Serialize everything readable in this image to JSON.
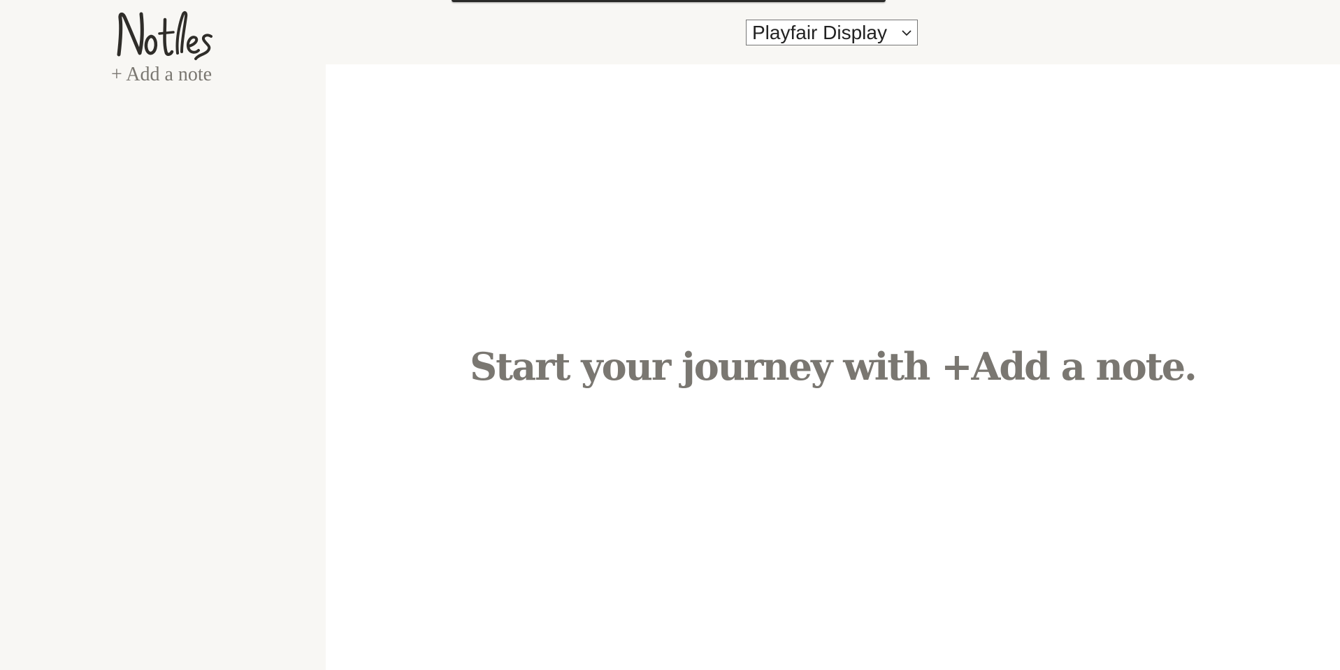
{
  "app": {
    "logo_text": "Notes"
  },
  "sidebar": {
    "add_note_label": "+ Add a note"
  },
  "toolbar": {
    "font_select": {
      "selected": "Playfair Display",
      "icon": "chevron-down-icon"
    }
  },
  "main": {
    "empty_message": "Start your journey with +Add a note."
  },
  "colors": {
    "background": "#f8f7f4",
    "pane": "#ffffff",
    "muted_text": "#7a7771",
    "logo_ink": "#2f2d29"
  }
}
